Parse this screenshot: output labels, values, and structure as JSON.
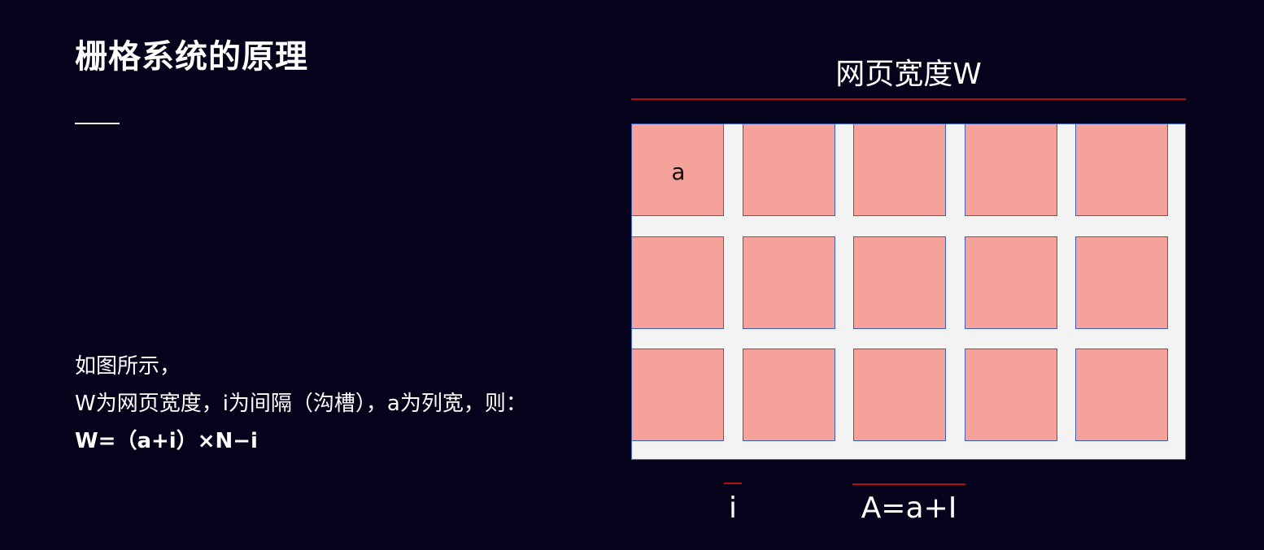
{
  "title": "栅格系统的原理",
  "description": {
    "line1": "如图所示，",
    "line2": "W为网页宽度，i为间隔（沟槽），a为列宽，则：",
    "formula": "W=（a+i）×N−i"
  },
  "diagram": {
    "width_label": "网页宽度W",
    "column_label": "a",
    "gutter_label": "i",
    "unit_label": "A=a+I",
    "rows": 3,
    "columns": 5,
    "colors": {
      "background": "#05021c",
      "frame_fill": "#f3f3f3",
      "frame_border": "#4a6fc9",
      "cell_fill": "#f5a39a",
      "cell_border": "#3d5fb8",
      "measure_line": "#b01010"
    }
  }
}
